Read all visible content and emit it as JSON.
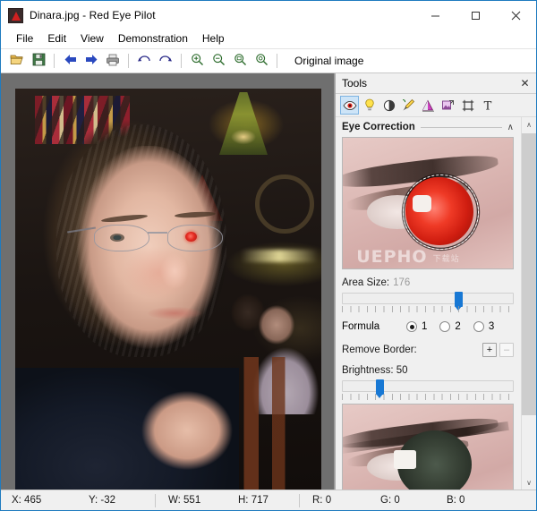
{
  "window": {
    "title": "Dinara.jpg - Red Eye Pilot",
    "app_icon": "red-eye-app-icon",
    "minimize_label": "–",
    "maximize_label": "□",
    "close_label": "✕"
  },
  "menu": {
    "items": [
      {
        "label": "File",
        "name": "menu-file"
      },
      {
        "label": "Edit",
        "name": "menu-edit"
      },
      {
        "label": "View",
        "name": "menu-view"
      },
      {
        "label": "Demonstration",
        "name": "menu-demonstration"
      },
      {
        "label": "Help",
        "name": "menu-help"
      }
    ]
  },
  "toolbar": {
    "buttons": [
      {
        "icon": "open-folder-icon",
        "name": "open-button"
      },
      {
        "icon": "save-icon",
        "name": "save-button"
      },
      {
        "icon": "arrow-left-icon",
        "name": "back-button"
      },
      {
        "icon": "arrow-right-icon",
        "name": "forward-button"
      },
      {
        "icon": "printer-icon",
        "name": "print-button"
      },
      {
        "icon": "undo-icon",
        "name": "undo-button"
      },
      {
        "icon": "redo-icon",
        "name": "redo-button"
      },
      {
        "icon": "zoom-in-icon",
        "name": "zoom-in-button"
      },
      {
        "icon": "zoom-out-icon",
        "name": "zoom-out-button"
      },
      {
        "icon": "zoom-fit-icon",
        "name": "zoom-fit-button"
      },
      {
        "icon": "zoom-actual-icon",
        "name": "zoom-actual-button"
      }
    ],
    "original_image_label": "Original image"
  },
  "tools_panel": {
    "title": "Tools",
    "close_label": "✕",
    "tool_icons": [
      {
        "name": "red-eye-tool-icon",
        "selected": true
      },
      {
        "name": "brightness-bulb-tool-icon",
        "selected": false
      },
      {
        "name": "contrast-tool-icon",
        "selected": false
      },
      {
        "name": "retouch-brush-tool-icon",
        "selected": false
      },
      {
        "name": "color-balance-tool-icon",
        "selected": false
      },
      {
        "name": "resize-image-tool-icon",
        "selected": false
      },
      {
        "name": "crop-tool-icon",
        "selected": false
      },
      {
        "name": "text-tool-icon",
        "selected": false
      }
    ],
    "section": {
      "title": "Eye Correction",
      "collapse_arrow": "∧"
    },
    "preview_top": {
      "name": "eye-preview-before",
      "watermark": "UEPHO",
      "watermark_small": "下载站"
    },
    "preview_bottom": {
      "name": "eye-preview-after"
    },
    "area_size": {
      "label": "Area Size:",
      "value": "176",
      "thumb_percent": 68
    },
    "formula": {
      "label": "Formula",
      "options": [
        {
          "label": "1",
          "selected": true
        },
        {
          "label": "2",
          "selected": false
        },
        {
          "label": "3",
          "selected": false
        }
      ]
    },
    "remove_border": {
      "label": "Remove Border:",
      "plus_label": "+",
      "minus_label": "–"
    },
    "brightness": {
      "label": "Brightness: 50",
      "thumb_percent": 22
    },
    "scrollbar": {
      "up_label": "∧",
      "down_label": "∨"
    }
  },
  "statusbar": {
    "cells": [
      {
        "label": "X: 465",
        "name": "status-x"
      },
      {
        "label": "Y: -32",
        "name": "status-y"
      },
      {
        "label": "W: 551",
        "name": "status-width"
      },
      {
        "label": "H: 717",
        "name": "status-height"
      },
      {
        "label": "R: 0",
        "name": "status-red"
      },
      {
        "label": "G: 0",
        "name": "status-green"
      },
      {
        "label": "B: 0",
        "name": "status-blue"
      }
    ]
  },
  "colors": {
    "accent": "#1878d4",
    "window_border": "#1f7bbf",
    "canvas_bg": "#6f6f6f",
    "panel_bg": "#f0f0f0",
    "selection_highlight": "#cde4f7",
    "red_eye": "#e21a10"
  }
}
